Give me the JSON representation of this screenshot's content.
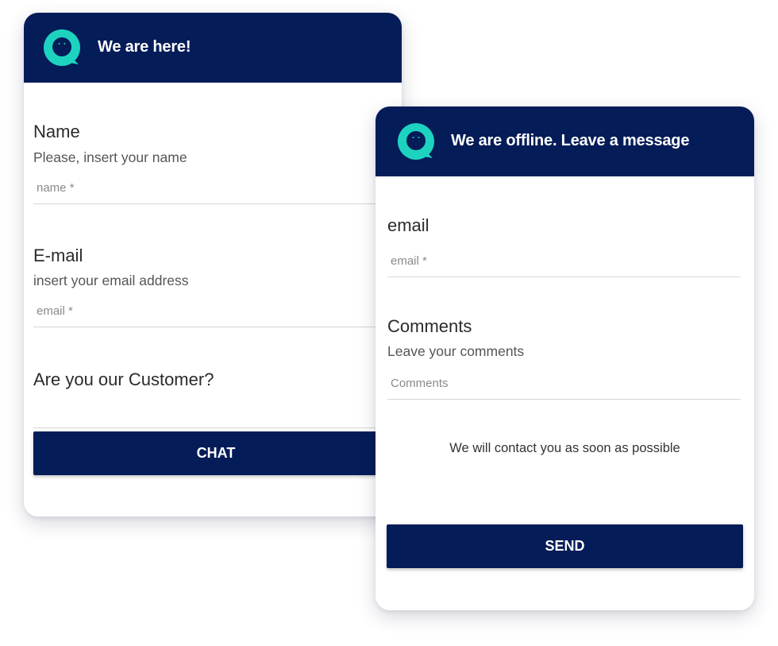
{
  "colors": {
    "header_bg": "#041c58",
    "logo_accent": "#1dd3c0",
    "button_bg": "#041c58"
  },
  "online_card": {
    "header": {
      "title": "We are here!",
      "logo": "chat-bubble-logo-icon"
    },
    "name": {
      "label": "Name",
      "help": "Please, insert your name",
      "placeholder": "name *"
    },
    "email": {
      "label": "E-mail",
      "help": "insert your email address",
      "placeholder": "email *"
    },
    "customer": {
      "label": "Are you our Customer?",
      "value": ""
    },
    "chat_button": "CHAT"
  },
  "offline_card": {
    "header": {
      "title": "We are offline. Leave a message",
      "logo": "chat-bubble-logo-icon"
    },
    "email": {
      "label": "email",
      "placeholder": "email *"
    },
    "comments": {
      "label": "Comments",
      "help": "Leave your comments",
      "placeholder": "Comments"
    },
    "note": "We will contact you as soon as possible",
    "send_button": "SEND"
  }
}
